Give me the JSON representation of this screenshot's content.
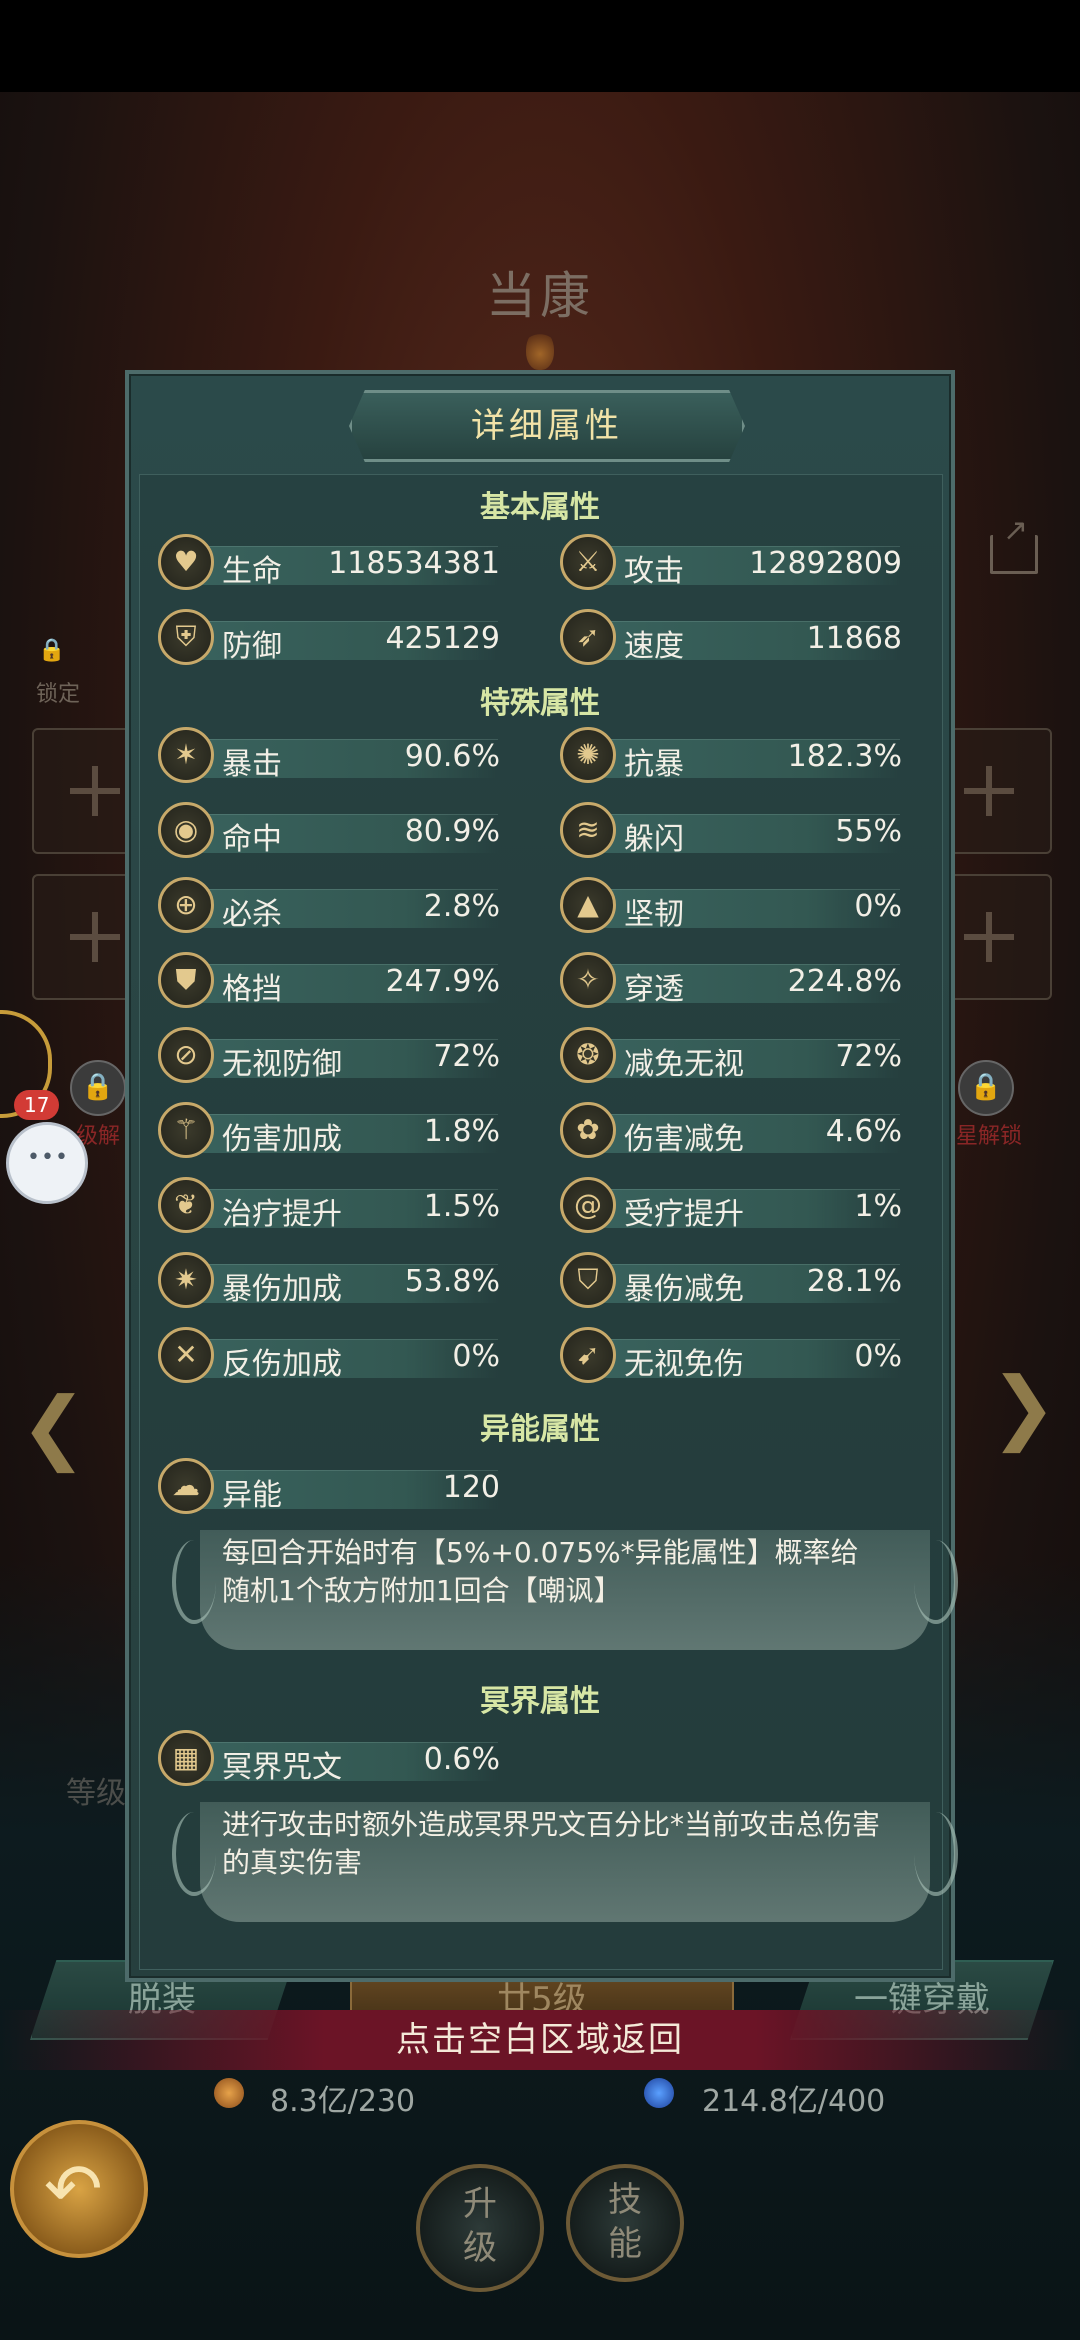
{
  "hero": {
    "name": "当康"
  },
  "background": {
    "lock_label": "锁定",
    "left_lock_text": "级解",
    "right_lock_text": "星解锁",
    "notification_count": "17",
    "ghost_level_label": "等级",
    "bottom": {
      "unequip": "脱装",
      "level_banner": "廿5级",
      "equip_all": "一键穿戴",
      "return_hint": "点击空白区域返回",
      "resource1": "8.3亿/230",
      "resource2": "214.8亿/400",
      "upgrade": "升级",
      "skill": "技能"
    }
  },
  "panel": {
    "title": "详细属性",
    "sections": {
      "basic": "基本属性",
      "special": "特殊属性",
      "esper": "异能属性",
      "netherworld": "冥界属性"
    },
    "basic": [
      {
        "label": "生命",
        "value": "118534381",
        "icon": "heart-icon"
      },
      {
        "label": "攻击",
        "value": "12892809",
        "icon": "sword-icon"
      },
      {
        "label": "防御",
        "value": "425129",
        "icon": "shield-icon"
      },
      {
        "label": "速度",
        "value": "11868",
        "icon": "runner-icon"
      }
    ],
    "special": [
      {
        "label": "暴击",
        "value": "90.6%",
        "icon": "crit-icon"
      },
      {
        "label": "抗暴",
        "value": "182.3%",
        "icon": "anti-crit-icon"
      },
      {
        "label": "命中",
        "value": "80.9%",
        "icon": "eye-icon"
      },
      {
        "label": "躲闪",
        "value": "55%",
        "icon": "dodge-icon"
      },
      {
        "label": "必杀",
        "value": "2.8%",
        "icon": "target-icon"
      },
      {
        "label": "坚韧",
        "value": "0%",
        "icon": "tenacity-icon"
      },
      {
        "label": "格挡",
        "value": "247.9%",
        "icon": "block-icon"
      },
      {
        "label": "穿透",
        "value": "224.8%",
        "icon": "pierce-icon"
      },
      {
        "label": "无视防御",
        "value": "72%",
        "icon": "ignore-defense-icon"
      },
      {
        "label": "减免无视",
        "value": "72%",
        "icon": "reduce-ignore-icon"
      },
      {
        "label": "伤害加成",
        "value": "1.8%",
        "icon": "damage-up-icon"
      },
      {
        "label": "伤害减免",
        "value": "4.6%",
        "icon": "damage-reduce-icon"
      },
      {
        "label": "治疗提升",
        "value": "1.5%",
        "icon": "leaf-icon"
      },
      {
        "label": "受疗提升",
        "value": "1%",
        "icon": "swirl-icon"
      },
      {
        "label": "暴伤加成",
        "value": "53.8%",
        "icon": "crit-damage-icon"
      },
      {
        "label": "暴伤减免",
        "value": "28.1%",
        "icon": "crit-reduce-icon"
      },
      {
        "label": "反伤加成",
        "value": "0%",
        "icon": "reflect-icon"
      },
      {
        "label": "无视免伤",
        "value": "0%",
        "icon": "dagger-icon"
      }
    ],
    "esper": {
      "label": "异能",
      "value": "120",
      "icon": "esper-icon",
      "desc": "每回合开始时有【5%+0.075%*异能属性】概率给随机1个敌方附加1回合【嘲讽】"
    },
    "netherworld": {
      "label": "冥界咒文",
      "value": "0.6%",
      "icon": "book-icon",
      "desc": "进行攻击时额外造成冥界咒文百分比*当前攻击总伤害的真实伤害"
    }
  }
}
